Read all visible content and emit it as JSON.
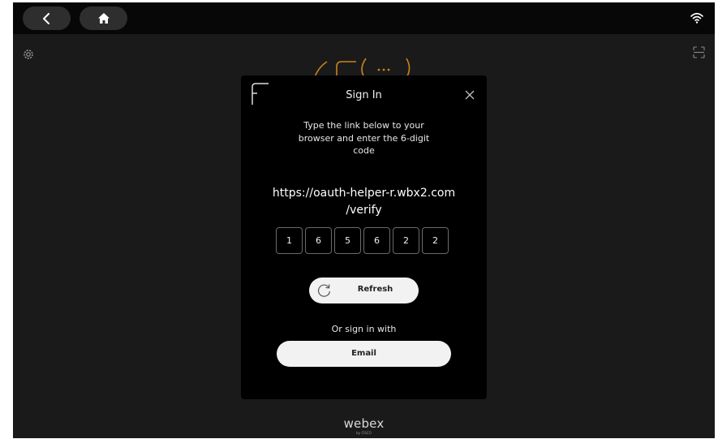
{
  "dialog": {
    "title": "Sign In",
    "instructions": "Type the link below to your browser and enter the 6-digit code",
    "url_line1": "https://oauth-helper-r.wbx2.com",
    "url_line2": "/verify",
    "code": [
      "1",
      "6",
      "5",
      "6",
      "2",
      "2"
    ],
    "refresh_label": "Refresh",
    "or_text": "Or sign in with",
    "email_label": "Email"
  },
  "brand": {
    "name": "webex",
    "sub": "by CISCO"
  },
  "icons": {
    "back": "chevron-left-icon",
    "home": "home-icon",
    "wifi": "wifi-icon",
    "settings": "gear-icon",
    "scan": "scan-icon",
    "close": "close-icon",
    "refresh": "refresh-icon"
  },
  "colors": {
    "background": "#1a1a1a",
    "topbar": "#070707",
    "modal": "#000000",
    "button": "#f2f2f2",
    "accent_art": "#c8841c"
  }
}
